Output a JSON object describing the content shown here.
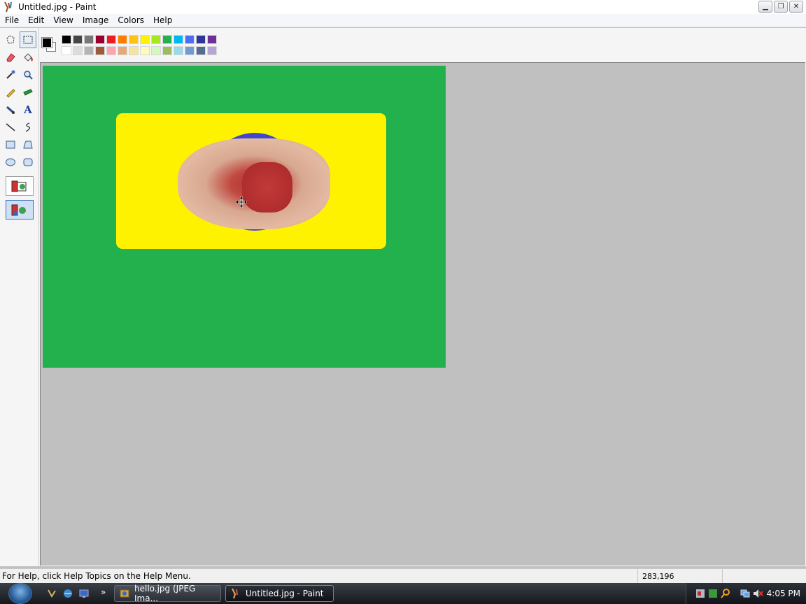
{
  "window": {
    "title": "Untitled.jpg - Paint",
    "buttons": [
      "minimize",
      "restore",
      "close"
    ]
  },
  "menu": [
    "File",
    "Edit",
    "View",
    "Image",
    "Colors",
    "Help"
  ],
  "toolbox": {
    "tools": [
      {
        "name": "free-form-select",
        "icon": "free-select-icon"
      },
      {
        "name": "select",
        "icon": "rect-select-icon",
        "selected": true
      },
      {
        "name": "eraser",
        "icon": "eraser-icon"
      },
      {
        "name": "fill-with-color",
        "icon": "fill-bucket-icon"
      },
      {
        "name": "pick-color",
        "icon": "eyedropper-icon"
      },
      {
        "name": "magnifier",
        "icon": "magnifier-icon"
      },
      {
        "name": "pencil",
        "icon": "pencil-icon"
      },
      {
        "name": "brush",
        "icon": "brush-icon"
      },
      {
        "name": "airbrush",
        "icon": "airbrush-icon"
      },
      {
        "name": "text",
        "icon": "text-icon",
        "glyph": "A"
      },
      {
        "name": "line",
        "icon": "line-icon"
      },
      {
        "name": "curve",
        "icon": "curve-icon"
      },
      {
        "name": "rectangle",
        "icon": "rectangle-icon"
      },
      {
        "name": "polygon",
        "icon": "polygon-icon"
      },
      {
        "name": "ellipse",
        "icon": "ellipse-icon"
      },
      {
        "name": "rounded-rectangle",
        "icon": "rounded-rect-icon"
      }
    ],
    "selection_modes": [
      {
        "name": "opaque",
        "active": false
      },
      {
        "name": "transparent",
        "active": true
      }
    ]
  },
  "palette": {
    "foreground": "#000000",
    "background": "#ffffff",
    "top_row": [
      "#000000",
      "#464646",
      "#787878",
      "#990030",
      "#ed1c24",
      "#ff7e00",
      "#ffc20e",
      "#fff200",
      "#a8e61d",
      "#22b14c",
      "#00b7ef",
      "#4d6df3",
      "#2f3699",
      "#6f3198"
    ],
    "bottom_row": [
      "#ffffff",
      "#dcdcdc",
      "#b4b4b4",
      "#9c5a3c",
      "#ffa3b1",
      "#e5aa7a",
      "#f5e49c",
      "#fff9bd",
      "#d3f9bc",
      "#9dbb61",
      "#99d9ea",
      "#709ad1",
      "#546d8e",
      "#b5a5d5"
    ]
  },
  "canvas": {
    "background": "#22b14c",
    "shape_color": "#fff200",
    "blob_color": "#3f48cc"
  },
  "status": {
    "help": "For Help, click Help Topics on the Help Menu.",
    "coords": "283,196"
  },
  "taskbar": {
    "tasks": [
      {
        "label": "hello.jpg (JPEG Ima...",
        "active": false
      },
      {
        "label": "Untitled.jpg - Paint",
        "active": true
      }
    ],
    "clock": "4:05 PM"
  }
}
